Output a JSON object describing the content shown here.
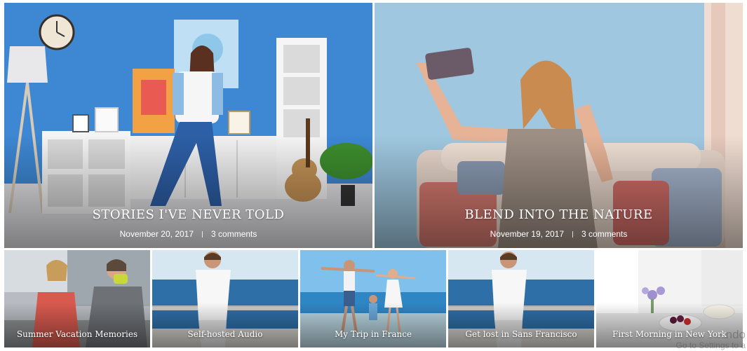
{
  "featured": [
    {
      "title": "STORIES I'VE NEVER TOLD",
      "date": "November 20, 2017",
      "comments": "3 comments"
    },
    {
      "title": "BLEND INTO THE NATURE",
      "date": "November 19, 2017",
      "comments": "3 comments"
    }
  ],
  "grid": [
    {
      "title": "Summer Vacation Memories"
    },
    {
      "title": "Self-hosted Audio"
    },
    {
      "title": "My Trip in France"
    },
    {
      "title": "Get lost in Sans Francisco"
    },
    {
      "title": "First Morning in New York"
    }
  ],
  "watermark": {
    "line1": "ndo",
    "line2": "Go to Settings to a"
  },
  "colors": {
    "accent_blue": "#3f86d1",
    "sky_blue": "#9ec6dd",
    "sea_blue": "#2f7fb8"
  }
}
